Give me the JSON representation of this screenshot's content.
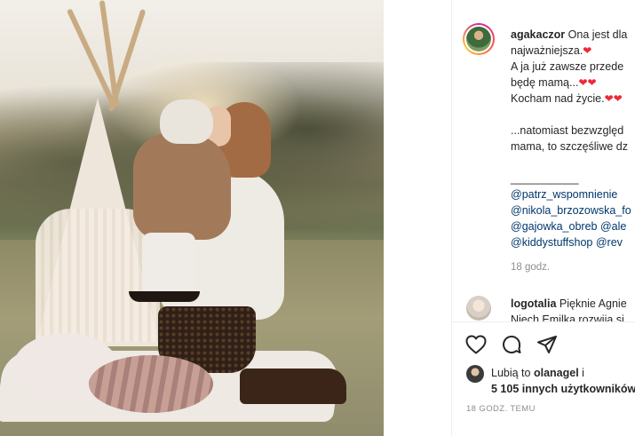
{
  "post": {
    "author": "agakaczor",
    "caption_lines": [
      "Ona jest dla",
      "najważniejsza.",
      "A ja już zawsze przede",
      "będę mamą...",
      "Kocham nad życie.",
      "",
      "...natomiast bezwzględ",
      "mama, to szczęśliwe dz",
      "",
      "___________"
    ],
    "mentions": [
      "@patrz_wspomnienie",
      "@nikola_brzozowska_fo",
      "@gajowka_obreb @ale",
      "@kiddystuffshop @rev"
    ],
    "time": "18 godz."
  },
  "comment": {
    "user": "logotalia",
    "text_line1": "Pięknie Agnie",
    "text_line2": "Niech Emilka rozwija si"
  },
  "actions": {
    "like_icon": "heart-outline-icon",
    "comment_icon": "comment-bubble-icon",
    "share_icon": "paper-plane-icon"
  },
  "likes": {
    "prefix": "Lubią to",
    "liker": "olanagel",
    "suffix": "i",
    "others": "5 105 innych użytkowników"
  },
  "timestamp": "18 GODZ. TEMU",
  "colors": {
    "heart": "#ed2939",
    "mention": "#00376b",
    "muted": "#8e8e8e"
  }
}
